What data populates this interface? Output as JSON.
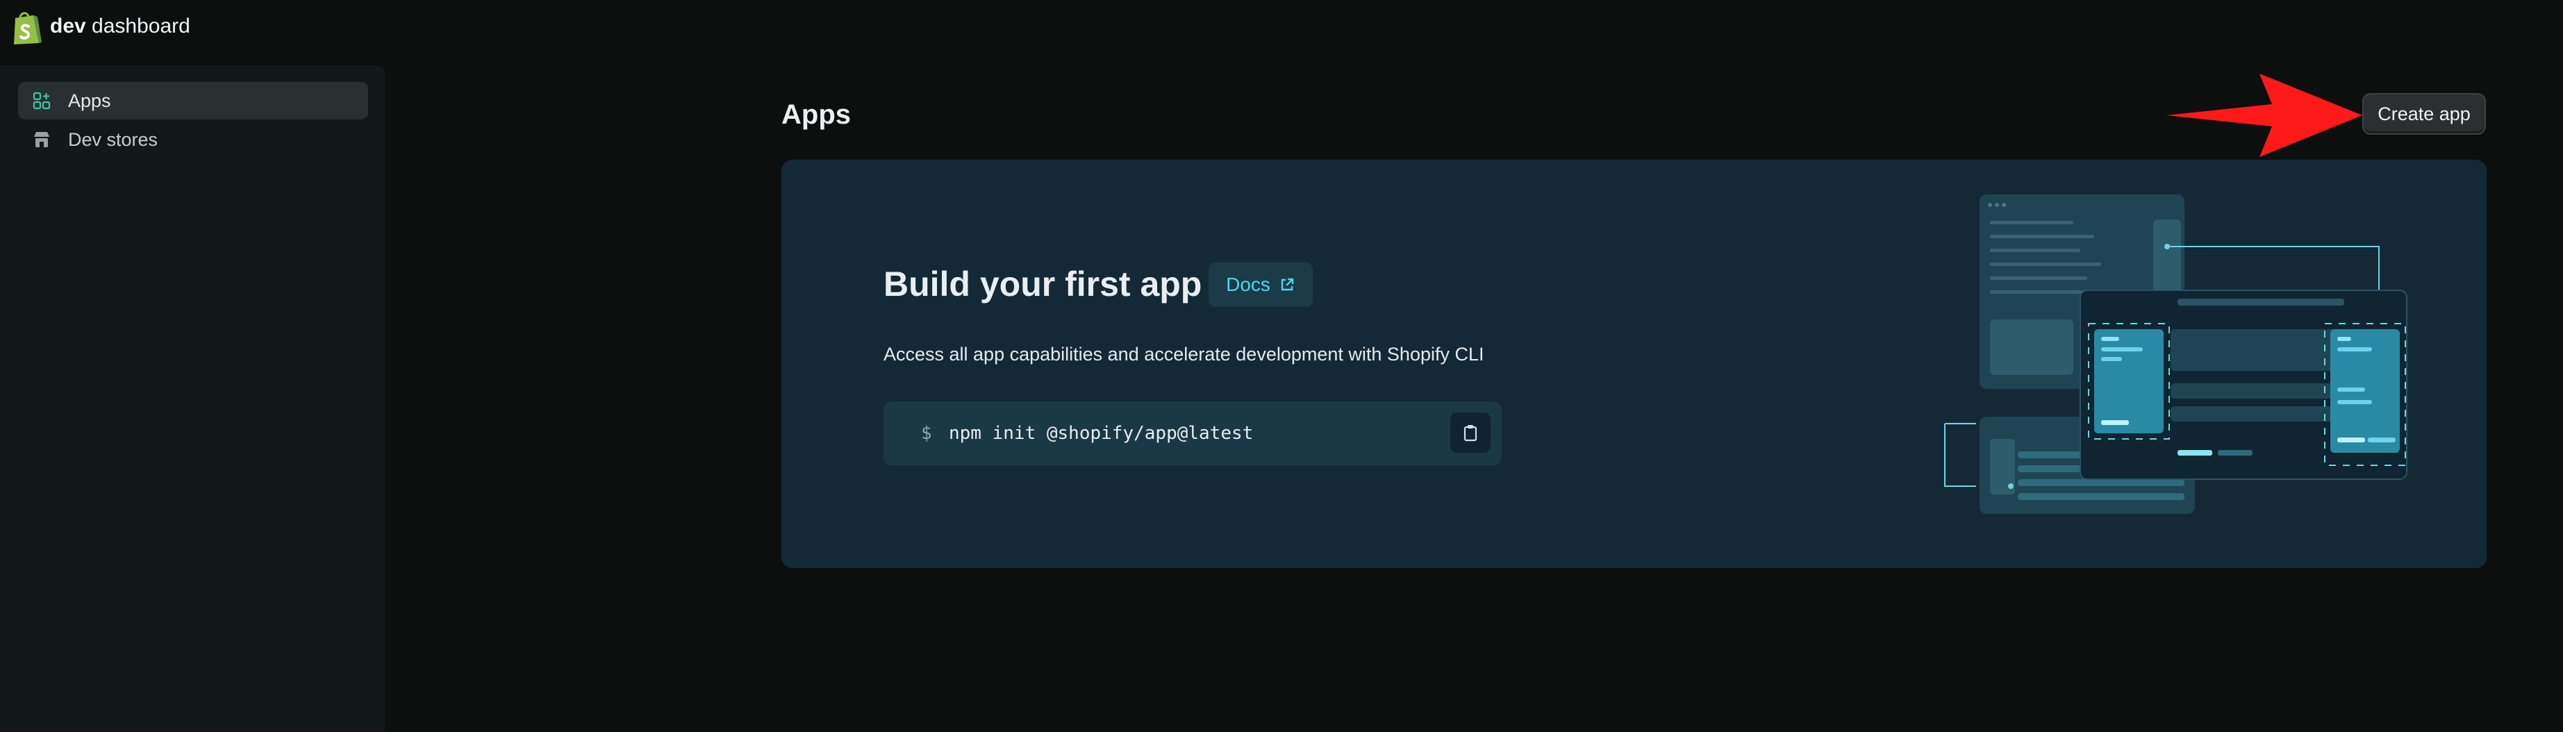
{
  "header": {
    "brand_bold": "dev",
    "brand_rest": "dashboard",
    "logo_icon": "shopify-bag-icon"
  },
  "sidebar": {
    "items": [
      {
        "label": "Apps",
        "icon": "apps-grid-icon",
        "active": true
      },
      {
        "label": "Dev stores",
        "icon": "store-icon",
        "active": false
      }
    ]
  },
  "main": {
    "title": "Apps",
    "create_button": "Create app",
    "card": {
      "title": "Build your first app",
      "docs_label": "Docs",
      "description": "Access all app capabilities and accelerate development with Shopify CLI",
      "prompt": "$",
      "command": "npm init @shopify/app@latest",
      "copy_icon": "clipboard-icon"
    }
  },
  "annotation": {
    "arrow_color": "#ff1a1a"
  },
  "colors": {
    "background": "#0d0f0f",
    "sidebar": "#131818",
    "card": "#132a36",
    "accent": "#4fd4ee",
    "brand_green": "#95bf47"
  }
}
